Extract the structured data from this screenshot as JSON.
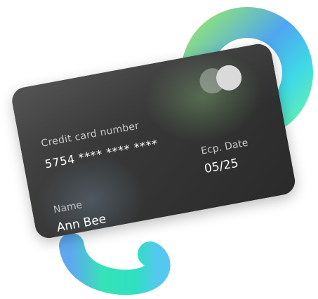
{
  "card": {
    "number_label": "Credit card number",
    "number_value": "5754 **** **** ****",
    "name_label": "Name",
    "name_value": "Ann Bee",
    "date_label": "Ecp. Date",
    "date_value": "05/25",
    "logo_icon": "card-brand-circles-icon"
  },
  "colors": {
    "card_base": "#363636",
    "ring_blue": "#5aa8ee",
    "ring_green": "#7be07b",
    "ring_teal": "#3ee6c4"
  }
}
